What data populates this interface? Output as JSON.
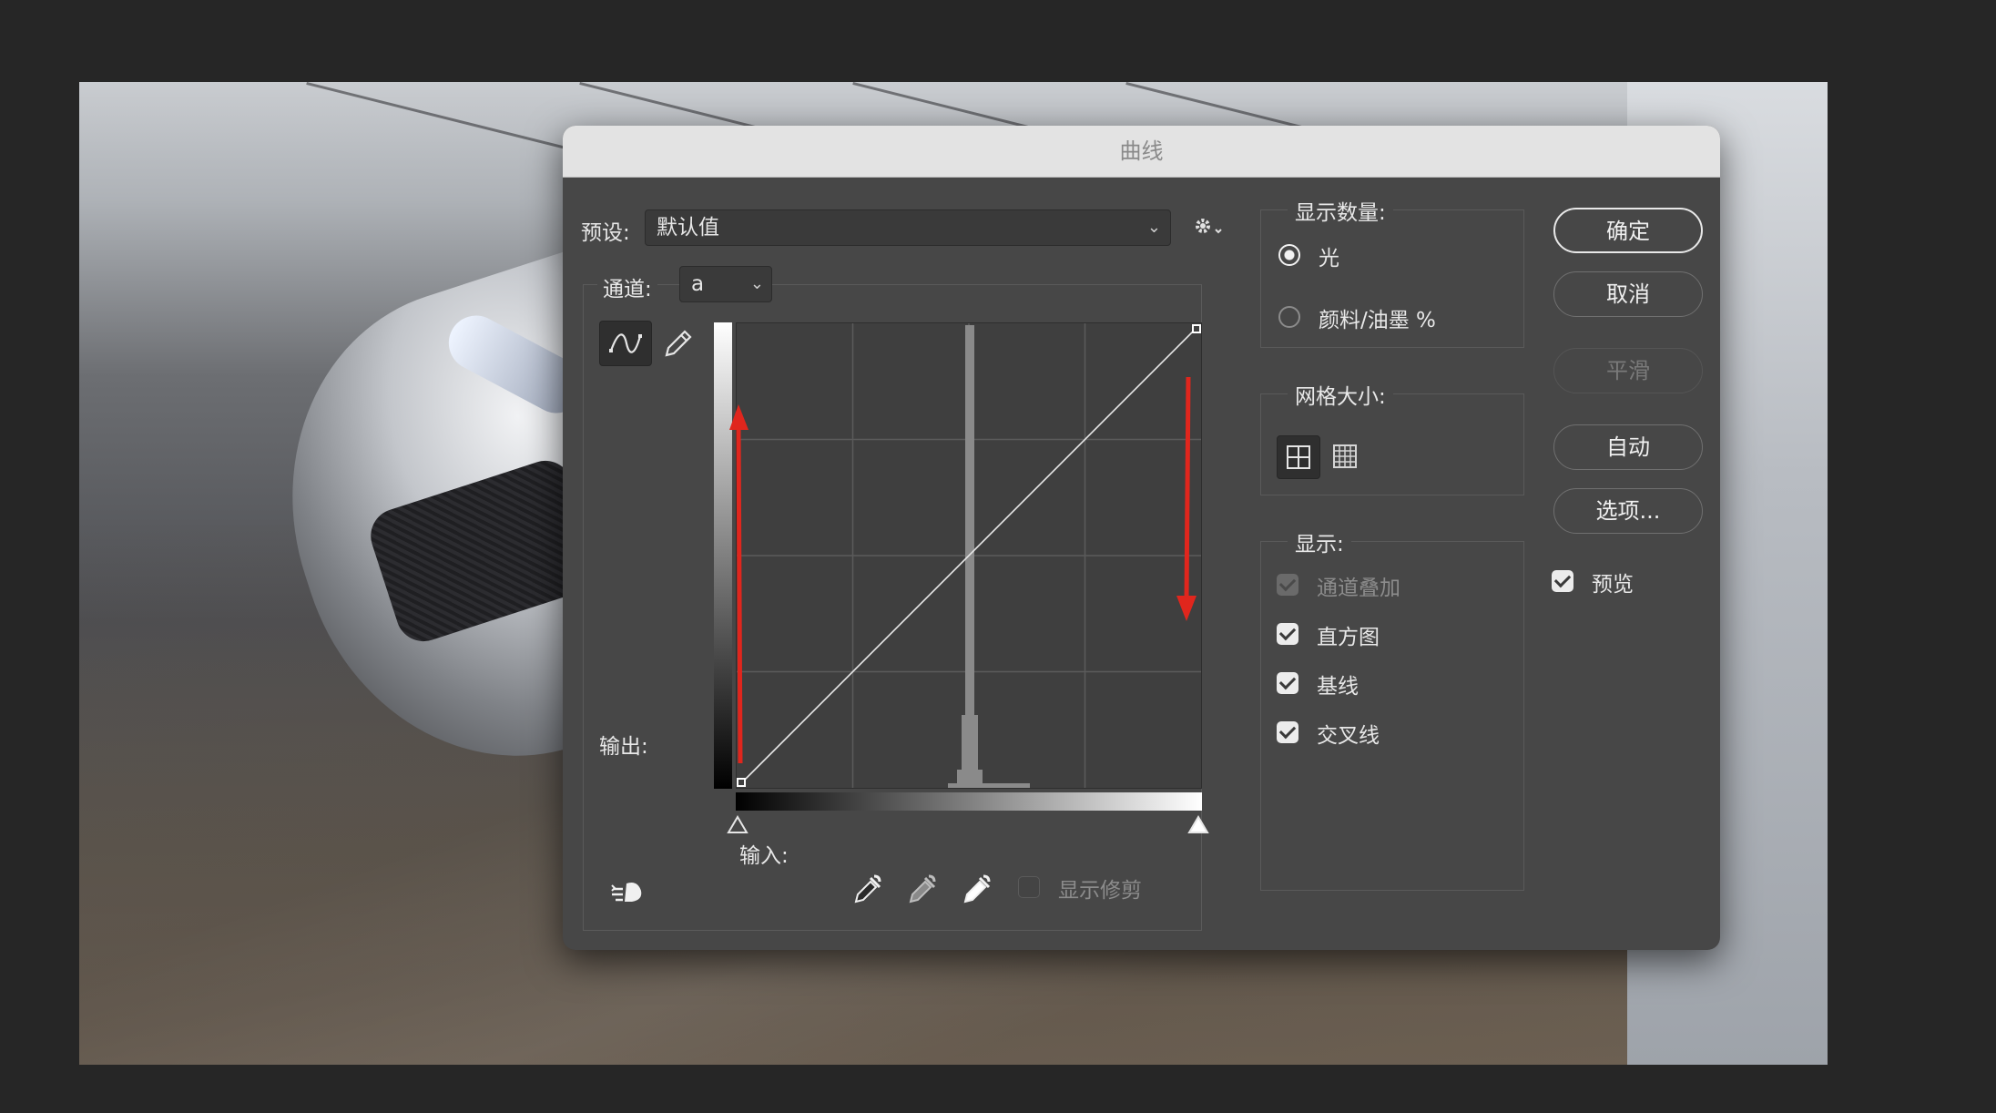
{
  "dialog": {
    "title": "曲线",
    "preset": {
      "label": "预设:",
      "value": "默认值"
    },
    "channel": {
      "label": "通道:",
      "value": "a"
    },
    "output_label": "输出:",
    "input_label": "输入:",
    "show_clipping_label": "显示修剪",
    "show_amount": {
      "title": "显示数量:",
      "options": [
        {
          "label": "光",
          "selected": true
        },
        {
          "label": "颜料/油墨 %",
          "selected": false
        }
      ]
    },
    "grid_size": {
      "title": "网格大小:",
      "selected": "simple"
    },
    "show": {
      "title": "显示:",
      "options": [
        {
          "label": "通道叠加",
          "checked": true,
          "disabled": true
        },
        {
          "label": "直方图",
          "checked": true,
          "disabled": false
        },
        {
          "label": "基线",
          "checked": true,
          "disabled": false
        },
        {
          "label": "交叉线",
          "checked": true,
          "disabled": false
        }
      ]
    },
    "buttons": {
      "ok": "确定",
      "cancel": "取消",
      "smooth": "平滑",
      "auto": "自动",
      "options": "选项..."
    },
    "preview": {
      "label": "预览",
      "checked": true
    }
  },
  "colors": {
    "dialog_bg": "#474747",
    "annotation_arrow": "#e0261d"
  },
  "icons": {
    "gear": "gear-icon",
    "curve_tool": "curve-tool-icon",
    "pencil_tool": "pencil-icon",
    "target_adjust": "target-adjust-icon",
    "eyedroppers": [
      "black-eyedropper-icon",
      "gray-eyedropper-icon",
      "white-eyedropper-icon"
    ]
  }
}
